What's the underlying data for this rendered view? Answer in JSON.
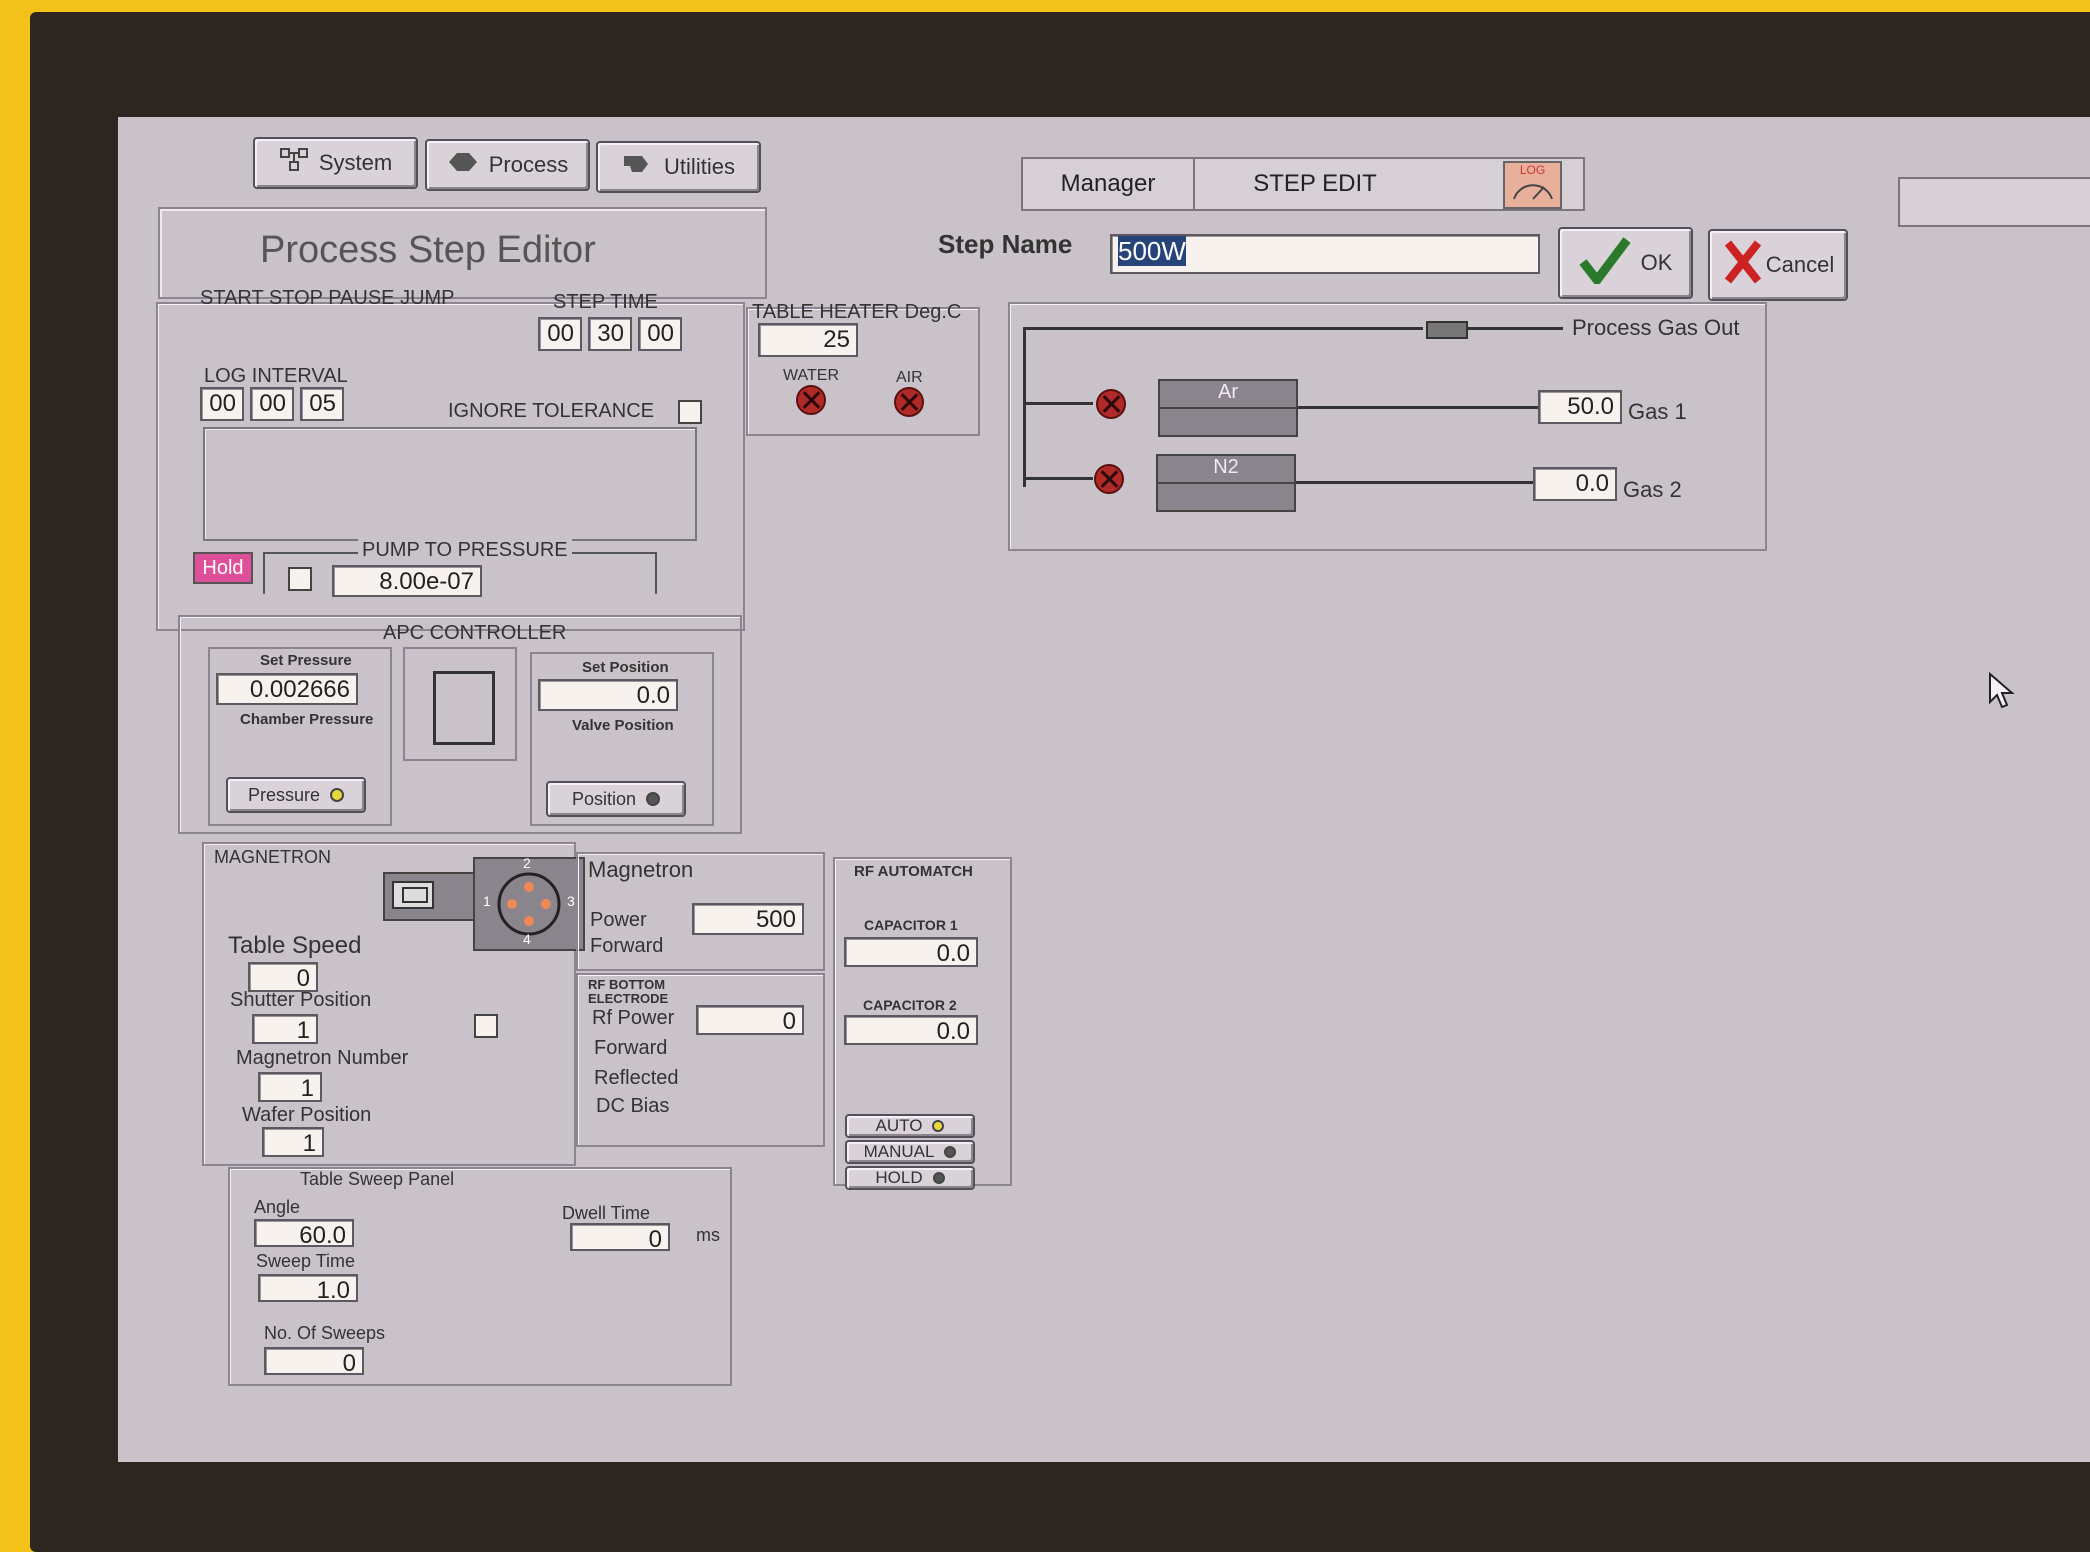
{
  "top_tabs": {
    "system": "System",
    "process": "Process",
    "utilities": "Utilities"
  },
  "status_bar": {
    "user": "Manager",
    "mode": "STEP EDIT",
    "log_label": "LOG"
  },
  "editor": {
    "title": "Process Step Editor",
    "step_name_label": "Step Name",
    "step_name_value": "500W",
    "ok_label": "OK",
    "cancel_label": "Cancel"
  },
  "step": {
    "controls_label": "START  STOP  PAUSE  JUMP",
    "step_time_label": "STEP TIME",
    "step_time": [
      "00",
      "30",
      "00"
    ],
    "log_interval_label": "LOG INTERVAL",
    "log_interval": [
      "00",
      "00",
      "05"
    ],
    "ignore_tolerance_label": "IGNORE TOLERANCE",
    "hold_label": "Hold",
    "pump_label": "PUMP TO PRESSURE",
    "pump_value": "8.00e-07"
  },
  "heater": {
    "label": "TABLE HEATER Deg.C",
    "value": "25",
    "water_label": "WATER",
    "air_label": "AIR"
  },
  "gas": {
    "process_out_label": "Process Gas Out",
    "gas1_name": "Ar",
    "gas1_value": "50.0",
    "gas1_label": "Gas 1",
    "gas2_name": "N2",
    "gas2_value": "0.0",
    "gas2_label": "Gas 2"
  },
  "apc": {
    "title": "APC CONTROLLER",
    "set_pressure_label": "Set Pressure",
    "set_pressure": "0.002666",
    "chamber_pressure_label": "Chamber Pressure",
    "set_position_label": "Set Position",
    "set_position": "0.0",
    "valve_position_label": "Valve Position",
    "pressure_button": "Pressure",
    "position_button": "Position"
  },
  "magnetron": {
    "title": "MAGNETRON",
    "table_speed_label": "Table Speed",
    "table_speed": "0",
    "shutter_label": "Shutter Position",
    "shutter": "1",
    "mag_number_label": "Magnetron Number",
    "mag_number": "1",
    "wafer_label": "Wafer Position",
    "wafer": "1",
    "pos_labels": [
      "1",
      "2",
      "3",
      "4"
    ]
  },
  "mag_power": {
    "title": "Magnetron",
    "power_label": "Power",
    "power": "500",
    "forward_label": "Forward"
  },
  "rf_bottom": {
    "title_line1": "RF BOTTOM",
    "title_line2": "ELECTRODE",
    "rf_power_label": "Rf Power",
    "rf_power": "0",
    "forward_label": "Forward",
    "reflected_label": "Reflected",
    "dc_bias_label": "DC Bias"
  },
  "automatch": {
    "title": "RF AUTOMATCH",
    "cap1_label": "CAPACITOR 1",
    "cap1": "0.0",
    "cap2_label": "CAPACITOR 2",
    "cap2": "0.0",
    "auto_label": "AUTO",
    "manual_label": "MANUAL",
    "hold_label": "HOLD"
  },
  "sweep": {
    "title": "Table Sweep Panel",
    "angle_label": "Angle",
    "angle": "60.0",
    "dwell_label": "Dwell Time",
    "dwell": "0",
    "dwell_unit": "ms",
    "sweep_time_label": "Sweep Time",
    "sweep_time": "1.0",
    "sweeps_label": "No. Of Sweeps",
    "sweeps": "0"
  }
}
